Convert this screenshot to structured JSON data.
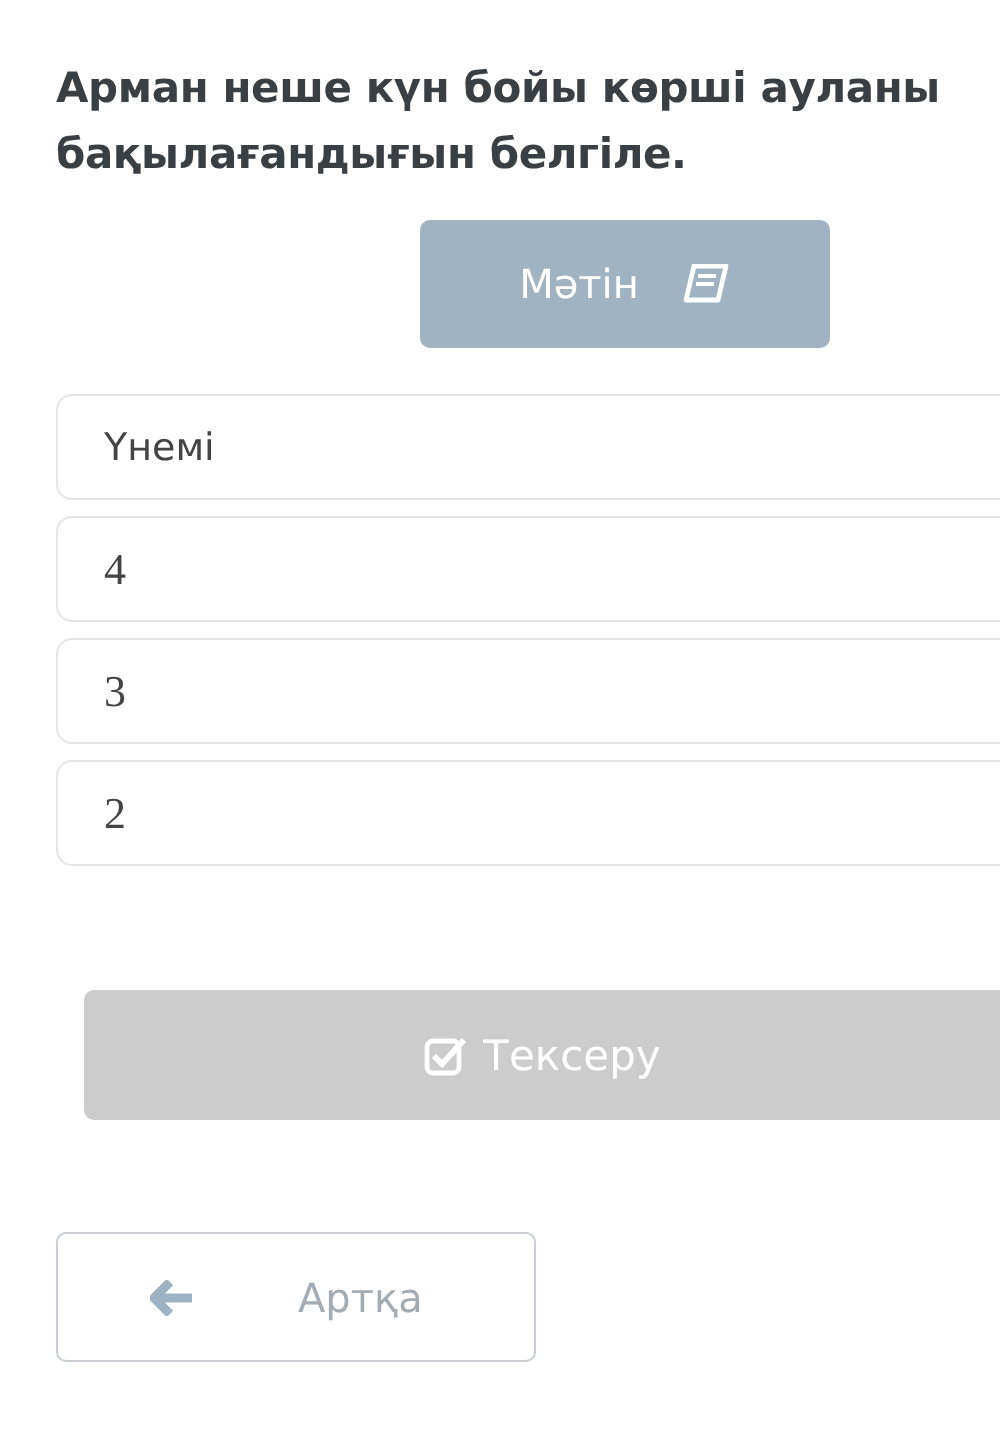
{
  "question": "Арман неше күн бойы көрші ауланы бақылағандығын белгіле.",
  "text_button": {
    "label": "Мәтін"
  },
  "options": [
    {
      "label": "Үнемі",
      "kind": "text",
      "selected": false
    },
    {
      "label": "4",
      "kind": "math",
      "selected": false
    },
    {
      "label": "3",
      "kind": "math",
      "selected": false
    },
    {
      "label": "2",
      "kind": "math",
      "selected": false
    }
  ],
  "check_button": {
    "label": "Тексеру",
    "disabled": true
  },
  "back_button": {
    "label": "Артқа"
  }
}
